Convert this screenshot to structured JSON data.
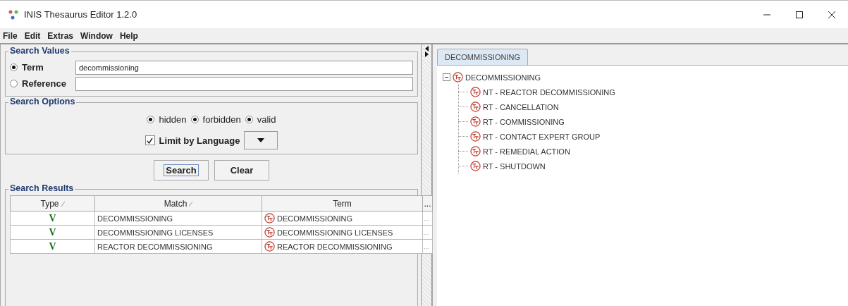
{
  "window": {
    "title": "INIS Thesaurus Editor 1.2.0"
  },
  "menu": [
    "File",
    "Edit",
    "Extras",
    "Window",
    "Help"
  ],
  "search_values": {
    "title": "Search Values",
    "options": [
      {
        "label": "Term",
        "selected": true,
        "value": "decommissioning"
      },
      {
        "label": "Reference",
        "selected": false
      }
    ]
  },
  "search_options": {
    "title": "Search Options",
    "filters": [
      {
        "label": "hidden",
        "checked": true
      },
      {
        "label": "forbidden",
        "checked": true
      },
      {
        "label": "valid",
        "checked": true
      }
    ],
    "limit_by_language": {
      "label": "Limit by Language",
      "checked": true
    }
  },
  "buttons": [
    {
      "label": "Search",
      "focused": true
    },
    {
      "label": "Clear",
      "focused": false
    }
  ],
  "search_results": {
    "title": "Search Results",
    "columns": [
      {
        "label": "Type",
        "sorted": true
      },
      {
        "label": "Match",
        "sorted": true
      },
      {
        "label": "Term",
        "sorted": false
      },
      {
        "label": "...",
        "sorted": false
      }
    ],
    "rows": [
      {
        "type": "V",
        "match": "DECOMMISSIONING",
        "term": "DECOMMISSIONING",
        "column_4": "..."
      },
      {
        "type": "V",
        "match": "DECOMMISSIONING LICENSES",
        "term": "DECOMMISSIONING LICENSES",
        "column_4": "..."
      },
      {
        "type": "V",
        "match": "REACTOR DECOMMISSIONING",
        "term": "REACTOR DECOMMISSIONING",
        "column_4": "..."
      }
    ]
  },
  "tabs": [
    {
      "label": "DECOMMISSIONING",
      "selected": true
    }
  ],
  "tree": {
    "label": "DECOMMISSIONING",
    "expanded": true,
    "children": [
      {
        "label": "NT - REACTOR DECOMMISSIONING"
      },
      {
        "label": "RT - CANCELLATION"
      },
      {
        "label": "RT - COMMISSIONING"
      },
      {
        "label": "RT - CONTACT EXPERT GROUP"
      },
      {
        "label": "RT - REMEDIAL ACTION"
      },
      {
        "label": "RT - SHUTDOWN"
      }
    ]
  }
}
